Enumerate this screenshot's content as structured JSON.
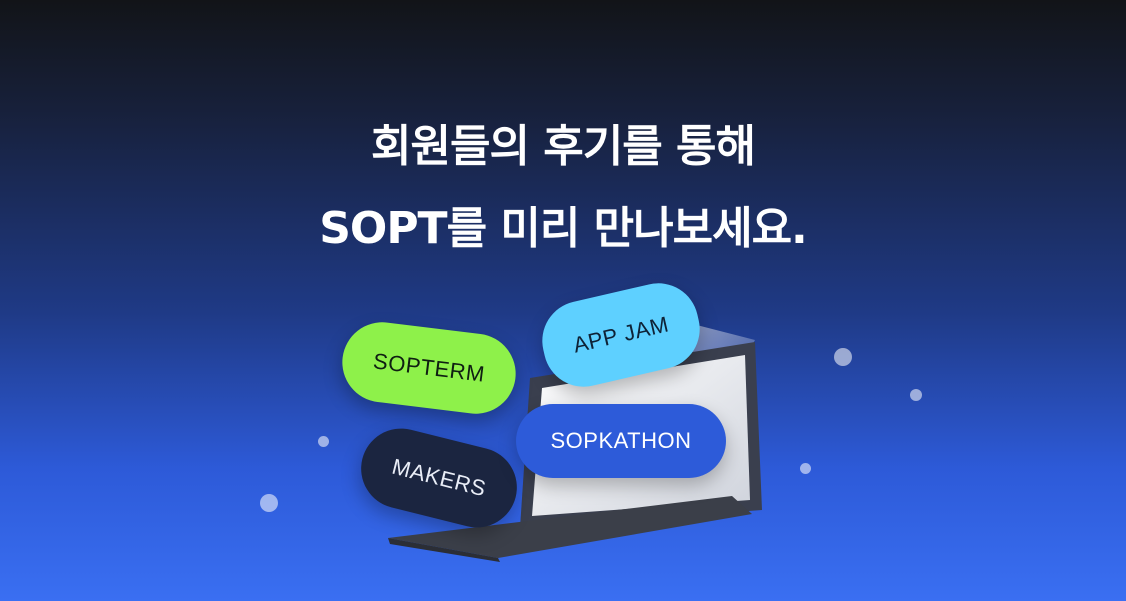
{
  "hero": {
    "headline_line1": "회원들의 후기를 통해",
    "headline_line2": "SOPT를 미리 만나보세요."
  },
  "tags": {
    "sopterm": "SOPTERM",
    "app_jam": "APP JAM",
    "sopkathon": "SOPKATHON",
    "makers": "MAKERS"
  },
  "colors": {
    "sopterm": "#8ef14a",
    "app_jam": "#5ed0ff",
    "sopkathon": "#2d5bd9",
    "makers": "#1b2540",
    "background_top": "#121418",
    "background_bottom": "#3a6ff2"
  },
  "illustration": {
    "icon": "laptop-icon"
  }
}
